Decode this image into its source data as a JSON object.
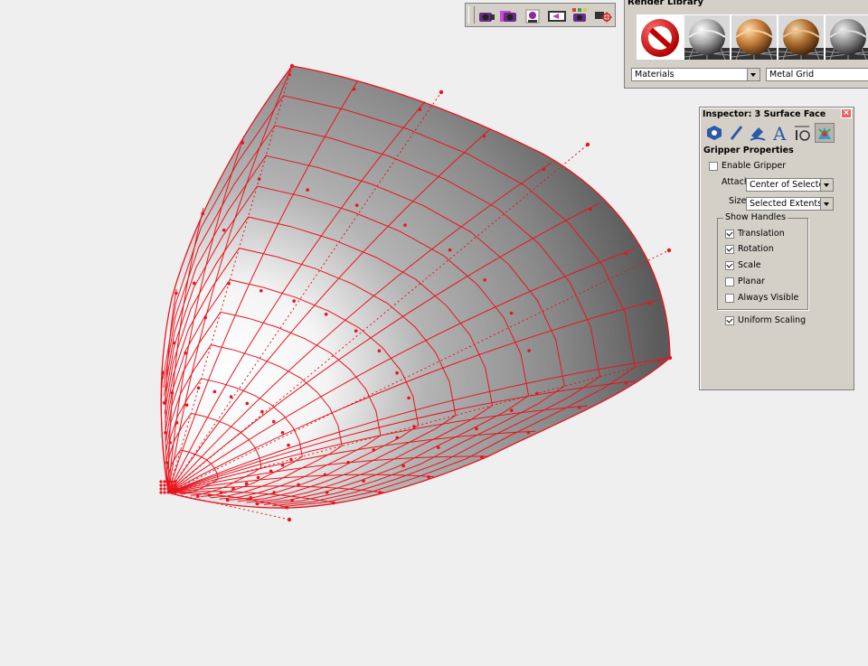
{
  "toolbar": {
    "buttons": [
      "camera-icon",
      "camera-settings-icon",
      "camera-pose-icon",
      "animation-frames-icon",
      "render-frames-icon",
      "camera-target-icon"
    ]
  },
  "render_library": {
    "title": "Render Library",
    "category": "Materials",
    "selected_material": "Metal Grid",
    "swatches": [
      "none-material",
      "chrome-sphere",
      "copper-sphere",
      "bronze-sphere",
      "steel-sphere"
    ]
  },
  "inspector": {
    "title": "Inspector:  3 Surface Face",
    "close": "×",
    "tabs": [
      "object-properties-icon",
      "edit-icon",
      "paint-icon",
      "text-icon",
      "dimension-icon",
      "gripper-icon"
    ],
    "section": "Gripper Properties",
    "enable_gripper": {
      "label": "Enable Gripper",
      "checked": false
    },
    "attach": {
      "label": "Attach",
      "value": "Center of Selected"
    },
    "size": {
      "label": "Size",
      "value": "Selected Extents"
    },
    "show_handles": {
      "title": "Show Handles",
      "items": [
        {
          "label": "Translation",
          "checked": true
        },
        {
          "label": "Rotation",
          "checked": true
        },
        {
          "label": "Scale",
          "checked": true
        },
        {
          "label": "Planar",
          "checked": false
        },
        {
          "label": "Always Visible",
          "checked": false
        }
      ]
    },
    "uniform_scaling": {
      "label": "Uniform Scaling",
      "checked": true
    }
  },
  "colors": {
    "grid_line": "#e8141e",
    "panel": "#d4d0c8",
    "background": "#efefef"
  }
}
